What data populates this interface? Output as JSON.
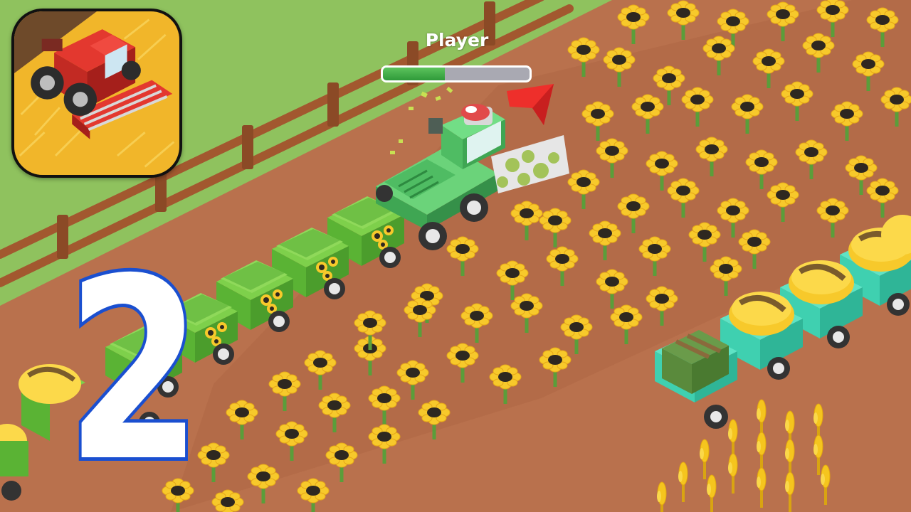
{
  "app_icon": {
    "icon": "red-combine-harvester-in-wheat-field-icon"
  },
  "hud": {
    "player_name": "Player",
    "progress": 0.42,
    "progress_color": "#3fae45"
  },
  "overlay": {
    "level_number": "2",
    "level_outline_color": "#1a4fd0"
  },
  "scene": {
    "description_icons": [
      "green-combine-harvester",
      "sunflower-trailer",
      "hay-bale-trailer",
      "direction-arrow-icon"
    ],
    "colors": {
      "grass": "#8fc25e",
      "dirt": "#b9714d",
      "fence": "#a2582f",
      "harvester": "#5cc86a",
      "trailer_green": "#6bbd3f",
      "trailer_teal": "#3fd0b0",
      "sunflower_petal": "#f7c92b",
      "sunflower_center": "#2e2820",
      "wheat": "#f5c51e"
    }
  }
}
